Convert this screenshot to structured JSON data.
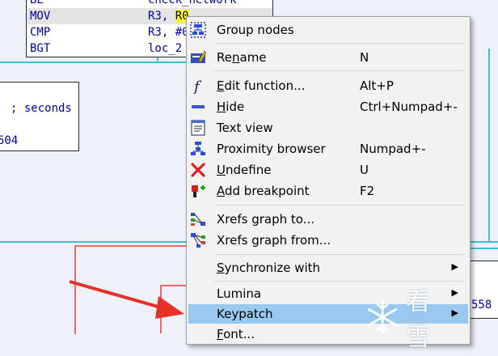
{
  "graph": {
    "top_block": {
      "rows": [
        {
          "mnemonic": "BL",
          "operand": "check_network"
        },
        {
          "mnemonic": "MOV",
          "operand_pre": "R3, ",
          "operand_hl": "R0"
        },
        {
          "mnemonic": "CMP",
          "operand": "R3, #0"
        },
        {
          "mnemonic": "BGT",
          "operand": "loc_2"
        }
      ]
    },
    "left_block": {
      "comment": "; seconds",
      "value": "504"
    },
    "right_block": {
      "value": "558"
    }
  },
  "menu": {
    "items": [
      {
        "icon": "group-nodes-icon",
        "label": "Group nodes",
        "underline": "",
        "shortcut": ""
      },
      {
        "icon": "rename-icon",
        "label_pre": "Re",
        "underline": "n",
        "label_post": "ame",
        "shortcut": "N"
      },
      {
        "icon": "function-icon",
        "underline": "E",
        "label_post": "dit function...",
        "shortcut": "Alt+P"
      },
      {
        "icon": "hide-icon",
        "underline": "H",
        "label_post": "ide",
        "shortcut": "Ctrl+Numpad+-"
      },
      {
        "icon": "text-view-icon",
        "label": "Text view",
        "shortcut": ""
      },
      {
        "icon": "proximity-browser-icon",
        "label": "Proximity browser",
        "shortcut": "Numpad+-"
      },
      {
        "icon": "undefine-icon",
        "underline": "U",
        "label_post": "ndefine",
        "shortcut": "U"
      },
      {
        "icon": "breakpoint-icon",
        "underline": "A",
        "label_post": "dd breakpoint",
        "shortcut": "F2"
      },
      {
        "icon": "xrefs-to-icon",
        "label": "Xrefs graph to...",
        "shortcut": ""
      },
      {
        "icon": "xrefs-from-icon",
        "label": "Xrefs graph from...",
        "shortcut": ""
      },
      {
        "label_pre": "",
        "underline": "S",
        "label_post": "ynchronize with",
        "shortcut": "",
        "submenu": true
      },
      {
        "label": "Lumina",
        "shortcut": "",
        "submenu": true
      },
      {
        "label": "Keypatch",
        "shortcut": "",
        "submenu": true,
        "highlighted": true
      },
      {
        "underline": "F",
        "label_post": "ont...",
        "shortcut": ""
      }
    ]
  },
  "watermark": {
    "text": "看雪"
  },
  "colors": {
    "menu_highlight": "#99c9ef",
    "code_text": "#0000a8",
    "edge_cyan": "#39c0d6",
    "edge_red": "#e36b6b",
    "annotation_arrow": "#e8302a"
  }
}
